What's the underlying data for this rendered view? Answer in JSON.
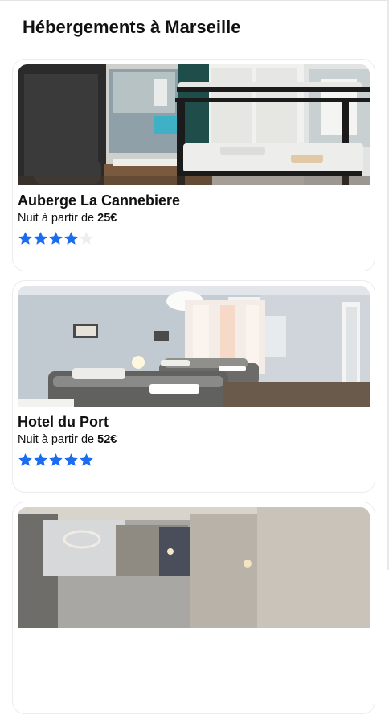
{
  "page": {
    "title": "Hébergements à Marseille"
  },
  "listings": [
    {
      "name": "Auberge La Cannebiere",
      "price_prefix": "Nuit à partir de",
      "price": "25€",
      "rating": 4,
      "rating_max": 5,
      "photo": "hostel-dorm-bunk-beds-photo"
    },
    {
      "name": "Hotel du Port",
      "price_prefix": "Nuit à partir de",
      "price": "52€",
      "rating": 5,
      "rating_max": 5,
      "photo": "hotel-twin-room-photo"
    },
    {
      "name": "",
      "price_prefix": "",
      "price": "",
      "rating": 0,
      "rating_max": 5,
      "photo": "hotel-room-photo"
    }
  ],
  "colors": {
    "star_filled": "#1a6cf0",
    "star_empty": "#eeeeee",
    "card_border": "#ececec"
  }
}
